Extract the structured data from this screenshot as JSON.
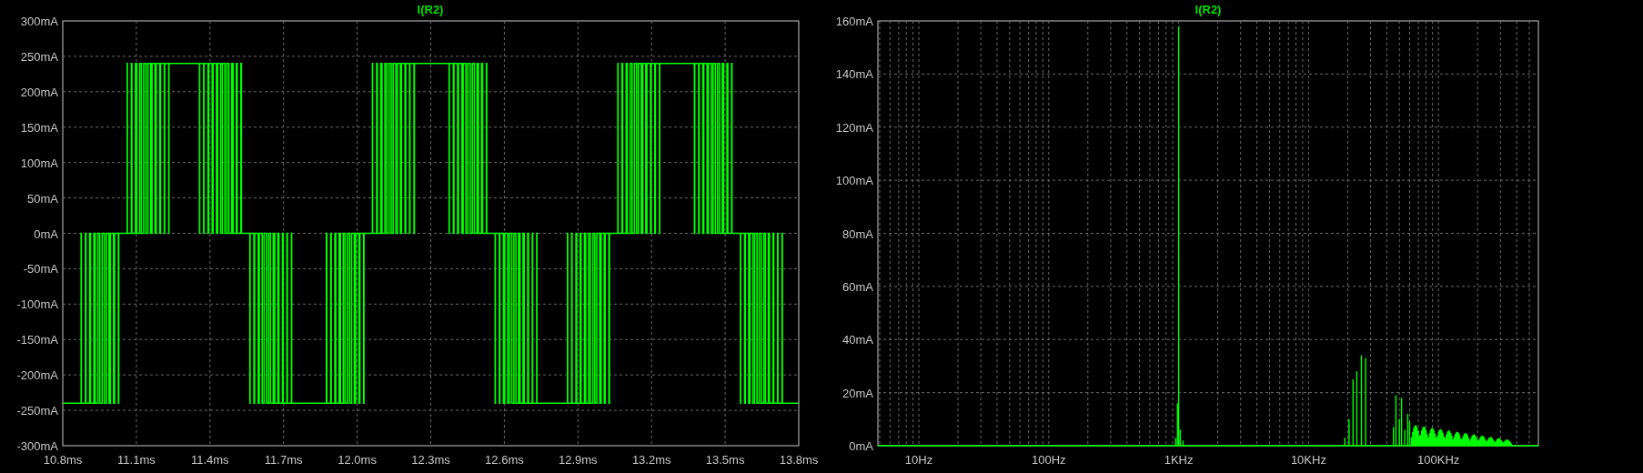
{
  "plots": [
    {
      "title": "I(R2)",
      "kind": "waveform",
      "y_ticks": [
        "300mA",
        "250mA",
        "200mA",
        "150mA",
        "100mA",
        "50mA",
        "0mA",
        "-50mA",
        "-100mA",
        "-150mA",
        "-200mA",
        "-250mA",
        "-300mA"
      ],
      "x_ticks": [
        "10.8ms",
        "11.1ms",
        "11.4ms",
        "11.7ms",
        "12.0ms",
        "12.3ms",
        "12.6ms",
        "12.9ms",
        "13.2ms",
        "13.5ms",
        "13.8ms"
      ]
    },
    {
      "title": "I(R2)",
      "kind": "spectrum",
      "y_ticks": [
        "160mA",
        "140mA",
        "120mA",
        "100mA",
        "80mA",
        "60mA",
        "40mA",
        "20mA",
        "0mA"
      ],
      "x_ticks": [
        "10Hz",
        "100Hz",
        "1KHz",
        "10KHz",
        "100KHz"
      ]
    }
  ]
}
